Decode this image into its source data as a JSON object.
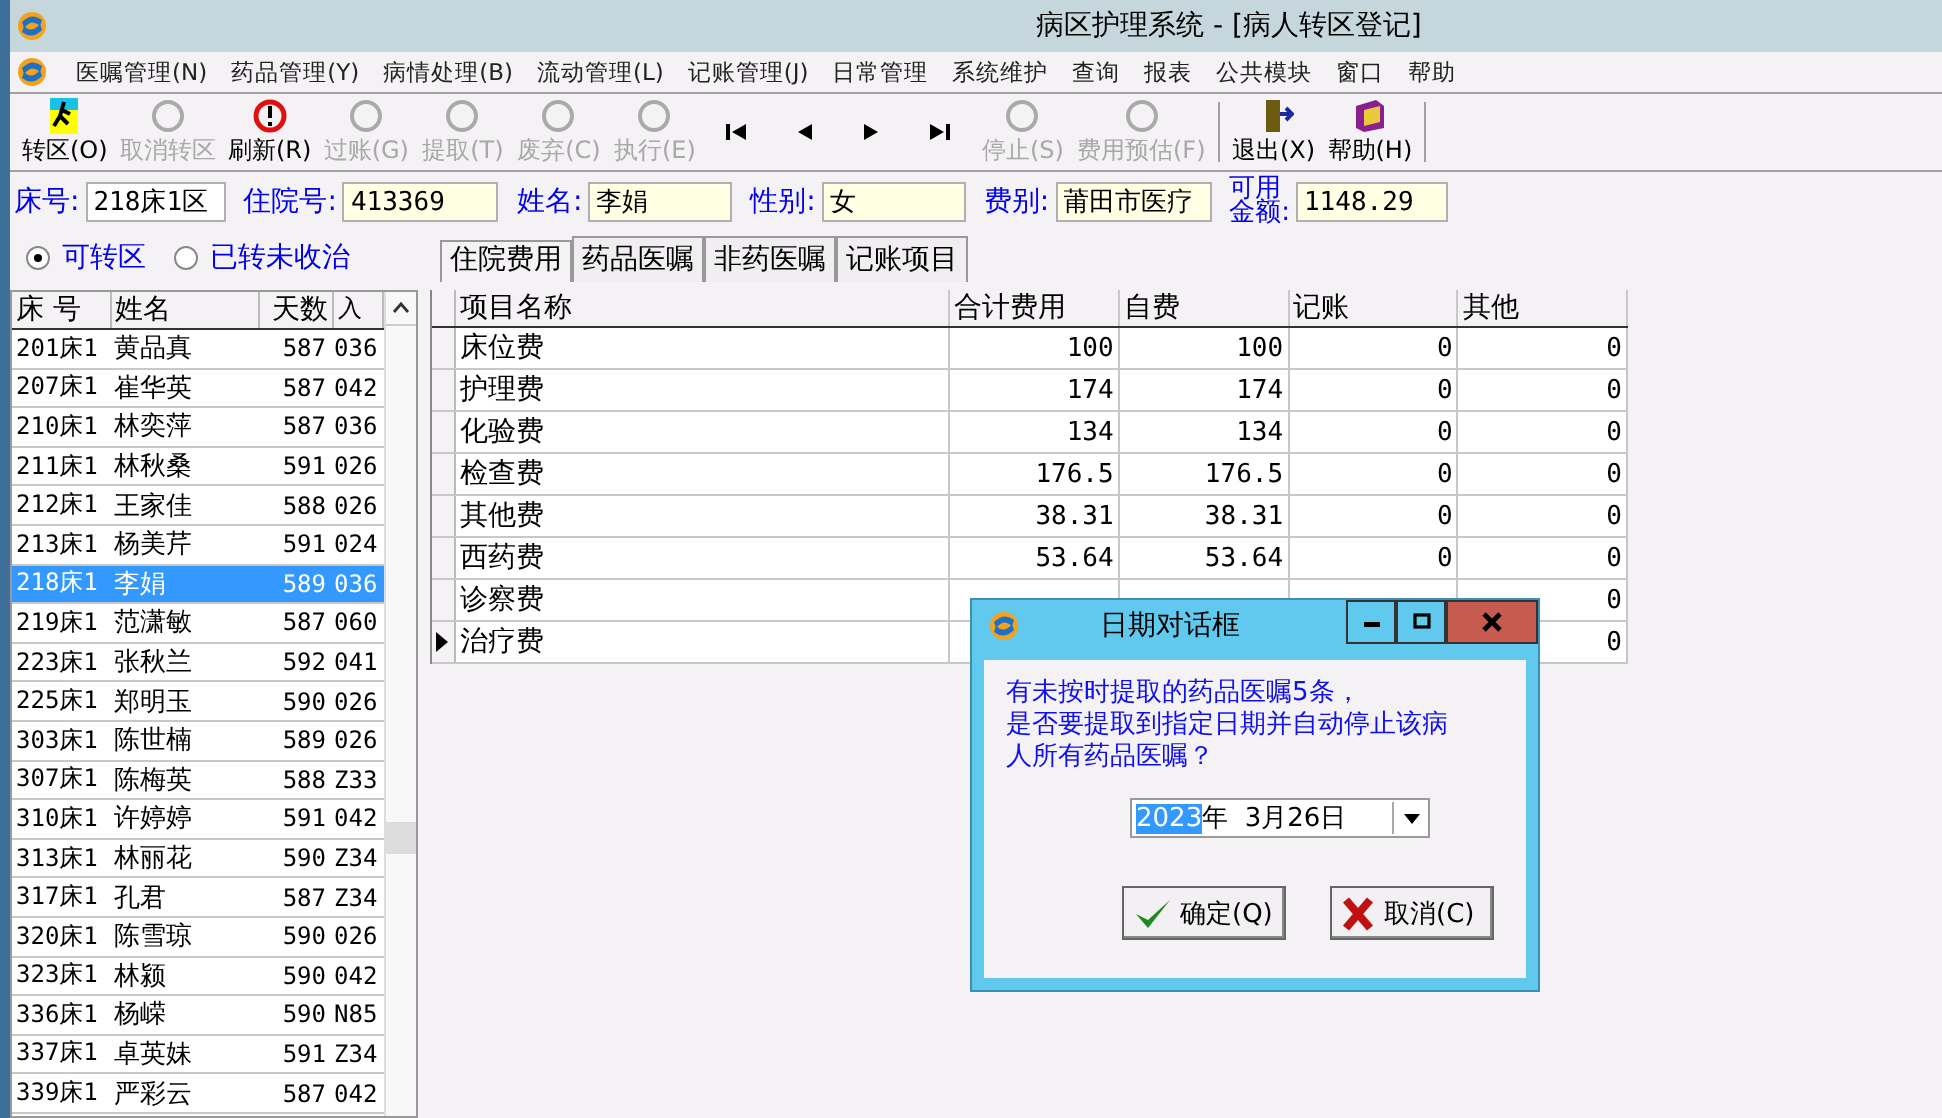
{
  "window": {
    "title": "病区护理系统 - [病人转区登记]"
  },
  "menu": [
    "医嘱管理(N)",
    "药品管理(Y)",
    "病情处理(B)",
    "流动管理(L)",
    "记账管理(J)",
    "日常管理",
    "系统维护",
    "查询",
    "报表",
    "公共模块",
    "窗口",
    "帮助"
  ],
  "toolbar": [
    {
      "kind": "button",
      "label": "转区(O)",
      "disabled": false
    },
    {
      "kind": "button",
      "label": "取消转区",
      "disabled": true
    },
    {
      "kind": "button",
      "label": "刷新(R)",
      "disabled": false
    },
    {
      "kind": "button",
      "label": "过账(G)",
      "disabled": true
    },
    {
      "kind": "button",
      "label": "提取(T)",
      "disabled": true
    },
    {
      "kind": "button",
      "label": "废弃(C)",
      "disabled": true
    },
    {
      "kind": "button",
      "label": "执行(E)",
      "disabled": true
    },
    {
      "kind": "first"
    },
    {
      "kind": "prev"
    },
    {
      "kind": "next"
    },
    {
      "kind": "last"
    },
    {
      "kind": "button",
      "label": "停止(S)",
      "disabled": true
    },
    {
      "kind": "button",
      "label": "费用预估(F)",
      "disabled": true
    },
    {
      "kind": "separator"
    },
    {
      "kind": "button",
      "label": "退出(X)",
      "disabled": false
    },
    {
      "kind": "button",
      "label": "帮助(H)",
      "disabled": false
    },
    {
      "kind": "separator"
    }
  ],
  "patient_fields": [
    {
      "label": "床号:",
      "value": "218床1区",
      "highlighted": false
    },
    {
      "label": "住院号:",
      "value": "413369",
      "highlighted": true
    },
    {
      "label": "姓名:",
      "value": "李娟",
      "highlighted": true
    },
    {
      "label": "性别:",
      "value": "女",
      "highlighted": true
    },
    {
      "label": "费别:",
      "value": "莆田市医疗",
      "highlighted": true
    },
    {
      "label_lines": [
        "可用",
        "金额:"
      ],
      "value": "1148.29",
      "highlighted": true
    }
  ],
  "filter_radios": [
    {
      "label": "可转区",
      "selected": true
    },
    {
      "label": "已转未收治",
      "selected": false
    }
  ],
  "tabs": [
    {
      "label": "住院费用",
      "selected": true
    },
    {
      "label": "药品医嘱",
      "selected": false
    },
    {
      "label": "非药医嘱",
      "selected": false
    },
    {
      "label": "记账项目",
      "selected": false
    }
  ],
  "patient_list": {
    "columns": [
      "床 号",
      "姓名",
      "天数",
      "入"
    ],
    "rows": [
      {
        "cells": [
          "201床1",
          "黄品真",
          "587",
          "036"
        ],
        "selected": false
      },
      {
        "cells": [
          "207床1",
          "崔华英",
          "587",
          "042"
        ],
        "selected": false
      },
      {
        "cells": [
          "210床1",
          "林奕萍",
          "587",
          "036"
        ],
        "selected": false
      },
      {
        "cells": [
          "211床1",
          "林秋桑",
          "591",
          "026"
        ],
        "selected": false
      },
      {
        "cells": [
          "212床1",
          "王家佳",
          "588",
          "026"
        ],
        "selected": false
      },
      {
        "cells": [
          "213床1",
          "杨美芹",
          "591",
          "024"
        ],
        "selected": false
      },
      {
        "cells": [
          "218床1",
          "李娟",
          "589",
          "036"
        ],
        "selected": true
      },
      {
        "cells": [
          "219床1",
          "范潇敏",
          "587",
          "060"
        ],
        "selected": false
      },
      {
        "cells": [
          "223床1",
          "张秋兰",
          "592",
          "041"
        ],
        "selected": false
      },
      {
        "cells": [
          "225床1",
          "郑明玉",
          "590",
          "026"
        ],
        "selected": false
      },
      {
        "cells": [
          "303床1",
          "陈世楠",
          "589",
          "026"
        ],
        "selected": false
      },
      {
        "cells": [
          "307床1",
          "陈梅英",
          "588",
          "Z33"
        ],
        "selected": false
      },
      {
        "cells": [
          "310床1",
          "许婷婷",
          "591",
          "042"
        ],
        "selected": false
      },
      {
        "cells": [
          "313床1",
          "林丽花",
          "590",
          "Z34"
        ],
        "selected": false
      },
      {
        "cells": [
          "317床1",
          "孔君",
          "587",
          "Z34"
        ],
        "selected": false
      },
      {
        "cells": [
          "320床1",
          "陈雪琼",
          "590",
          "026"
        ],
        "selected": false
      },
      {
        "cells": [
          "323床1",
          "林颍",
          "590",
          "042"
        ],
        "selected": false
      },
      {
        "cells": [
          "336床1",
          "杨嵘",
          "590",
          "N85"
        ],
        "selected": false
      },
      {
        "cells": [
          "337床1",
          "卓英妹",
          "591",
          "Z34"
        ],
        "selected": false
      },
      {
        "cells": [
          "339床1",
          "严彩云",
          "587",
          "042"
        ],
        "selected": false
      }
    ]
  },
  "fee_table": {
    "columns": [
      "项目名称",
      "合计费用",
      "自费",
      "记账",
      "其他"
    ],
    "rows": [
      {
        "cells": [
          "床位费",
          "100",
          "100",
          "0",
          "0"
        ],
        "current": false
      },
      {
        "cells": [
          "护理费",
          "174",
          "174",
          "0",
          "0"
        ],
        "current": false
      },
      {
        "cells": [
          "化验费",
          "134",
          "134",
          "0",
          "0"
        ],
        "current": false
      },
      {
        "cells": [
          "检查费",
          "176.5",
          "176.5",
          "0",
          "0"
        ],
        "current": false
      },
      {
        "cells": [
          "其他费",
          "38.31",
          "38.31",
          "0",
          "0"
        ],
        "current": false
      },
      {
        "cells": [
          "西药费",
          "53.64",
          "53.64",
          "0",
          "0"
        ],
        "current": false
      },
      {
        "cells": [
          "诊察费",
          null,
          null,
          null,
          "0"
        ],
        "current": false
      },
      {
        "cells": [
          "治疗费",
          null,
          null,
          null,
          "0"
        ],
        "current": true
      }
    ]
  },
  "dialog": {
    "title": "日期对话框",
    "message_lines": [
      "有未按时提取的药品医嘱5条，",
      "是否要提取到指定日期并自动停止该病",
      "人所有药品医嘱？"
    ],
    "date": {
      "year": "2023",
      "rest": "年  3月26日"
    },
    "buttons": [
      {
        "kind": "ok",
        "label": "确定(Q)"
      },
      {
        "kind": "cancel",
        "label": "取消(C)"
      }
    ]
  }
}
